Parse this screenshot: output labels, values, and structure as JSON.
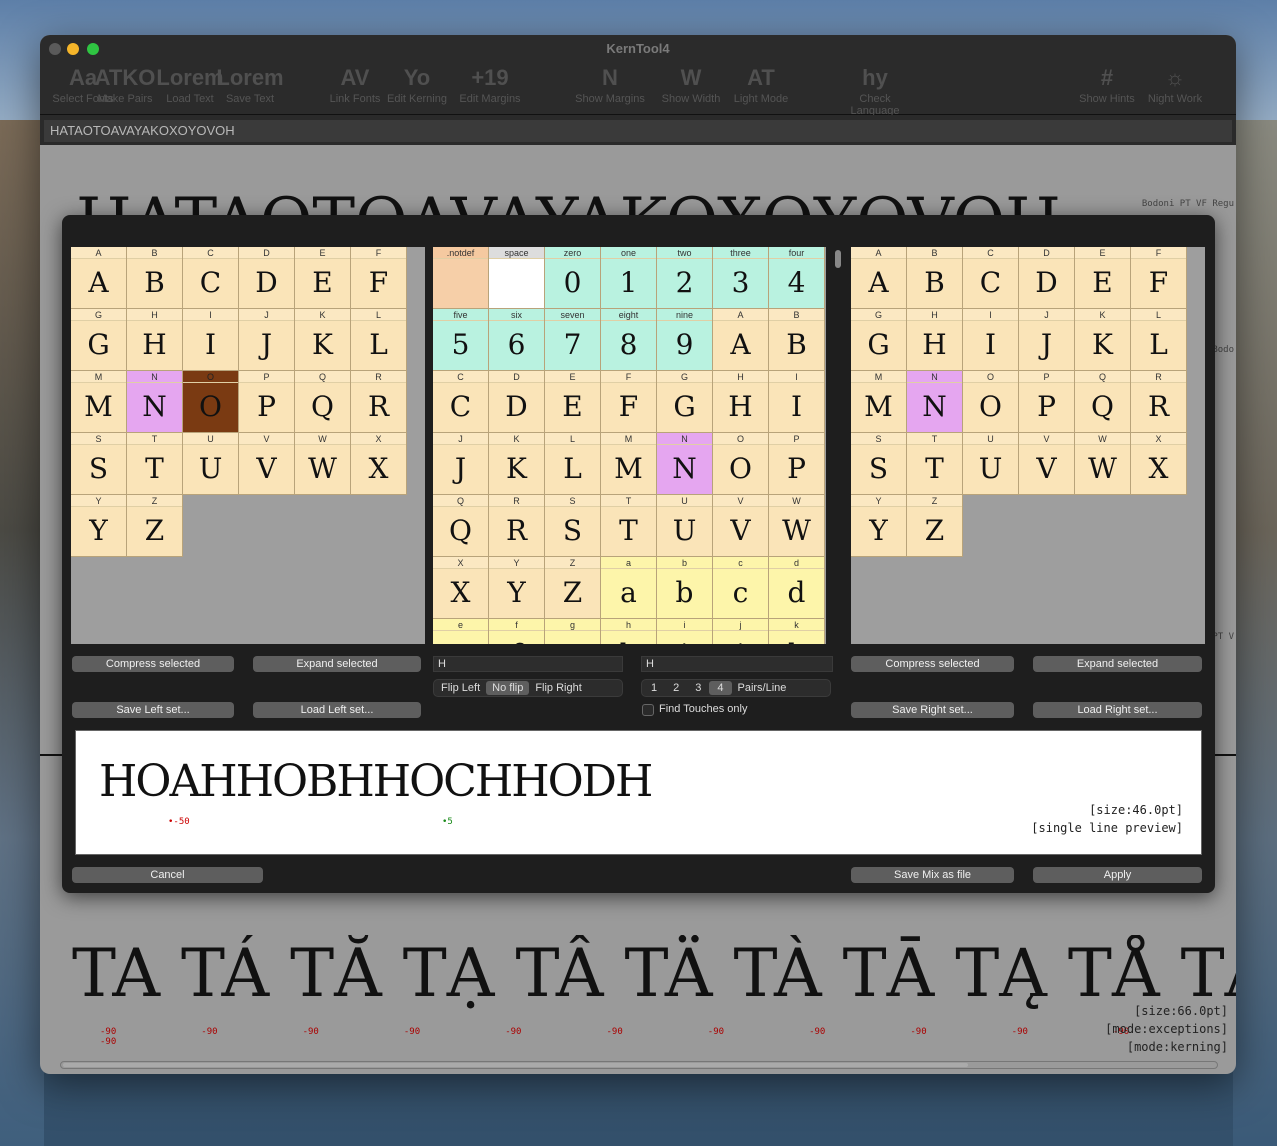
{
  "app": {
    "title": "KernTool4"
  },
  "toolbar": [
    {
      "label": "Select Fonts",
      "icon": "Aa"
    },
    {
      "label": "Make Pairs",
      "icon": "ATKO"
    },
    {
      "label": "Load Text",
      "icon": "Lorem"
    },
    {
      "label": "Save Text",
      "icon": "Lorem"
    },
    {
      "label": "Link Fonts",
      "icon": "AV"
    },
    {
      "label": "Edit Kerning",
      "icon": "Yo"
    },
    {
      "label": "Edit Margins",
      "icon": "+19"
    },
    {
      "label": "Show Margins",
      "icon": "N"
    },
    {
      "label": "Show Width",
      "icon": "W"
    },
    {
      "label": "Light Mode",
      "icon": "AT"
    },
    {
      "label": "Check Language",
      "icon": "hy"
    },
    {
      "label": "Show Hints",
      "icon": "#"
    },
    {
      "label": "Night Work",
      "icon": "☼"
    }
  ],
  "pairs_field": "HATAOTOAVAYAKOXOYOVOH",
  "main": {
    "big_text": "HATAOTOAVAYAKOXOYOVOH",
    "font_label": "Bodoni PT VF Regu",
    "side_label": "Bodo",
    "side_label2": "PT V"
  },
  "bottom": {
    "text": "TA TÁ TĂ TẠ TÂ TÄ TÀ TĀ TĄ TÅ TǺ TÃ",
    "kern_values": [
      "-90",
      "-90",
      "-90",
      "-90",
      "-90",
      "-90",
      "-90",
      "-90",
      "-90",
      "-90",
      "-90",
      "-90"
    ],
    "size": "[size:66.0pt]",
    "mode1": "[mode:exceptions]",
    "mode2": "[mode:kerning]"
  },
  "left_set": {
    "cells": [
      {
        "n": "A",
        "g": "A"
      },
      {
        "n": "B",
        "g": "B"
      },
      {
        "n": "C",
        "g": "C"
      },
      {
        "n": "D",
        "g": "D"
      },
      {
        "n": "E",
        "g": "E"
      },
      {
        "n": "F",
        "g": "F"
      },
      {
        "n": "G",
        "g": "G"
      },
      {
        "n": "H",
        "g": "H"
      },
      {
        "n": "I",
        "g": "I"
      },
      {
        "n": "J",
        "g": "J"
      },
      {
        "n": "K",
        "g": "K"
      },
      {
        "n": "L",
        "g": "L"
      },
      {
        "n": "M",
        "g": "M"
      },
      {
        "n": "N",
        "g": "N",
        "s": "sel"
      },
      {
        "n": "O",
        "g": "O",
        "s": "dark"
      },
      {
        "n": "P",
        "g": "P"
      },
      {
        "n": "Q",
        "g": "Q"
      },
      {
        "n": "R",
        "g": "R"
      },
      {
        "n": "S",
        "g": "S"
      },
      {
        "n": "T",
        "g": "T"
      },
      {
        "n": "U",
        "g": "U"
      },
      {
        "n": "V",
        "g": "V"
      },
      {
        "n": "W",
        "g": "W"
      },
      {
        "n": "X",
        "g": "X"
      },
      {
        "n": "Y",
        "g": "Y"
      },
      {
        "n": "Z",
        "g": "Z"
      }
    ]
  },
  "center_set": {
    "cells": [
      {
        "n": ".notdef",
        "g": "",
        "s": "notdef"
      },
      {
        "n": "space",
        "g": "",
        "s": "space"
      },
      {
        "n": "zero",
        "g": "0",
        "s": "fig"
      },
      {
        "n": "one",
        "g": "1",
        "s": "fig"
      },
      {
        "n": "two",
        "g": "2",
        "s": "fig"
      },
      {
        "n": "three",
        "g": "3",
        "s": "fig"
      },
      {
        "n": "four",
        "g": "4",
        "s": "fig"
      },
      {
        "n": "five",
        "g": "5",
        "s": "fig"
      },
      {
        "n": "six",
        "g": "6",
        "s": "fig"
      },
      {
        "n": "seven",
        "g": "7",
        "s": "fig"
      },
      {
        "n": "eight",
        "g": "8",
        "s": "fig"
      },
      {
        "n": "nine",
        "g": "9",
        "s": "fig"
      },
      {
        "n": "A",
        "g": "A"
      },
      {
        "n": "B",
        "g": "B"
      },
      {
        "n": "C",
        "g": "C"
      },
      {
        "n": "D",
        "g": "D"
      },
      {
        "n": "E",
        "g": "E"
      },
      {
        "n": "F",
        "g": "F"
      },
      {
        "n": "G",
        "g": "G"
      },
      {
        "n": "H",
        "g": "H"
      },
      {
        "n": "I",
        "g": "I"
      },
      {
        "n": "J",
        "g": "J"
      },
      {
        "n": "K",
        "g": "K"
      },
      {
        "n": "L",
        "g": "L"
      },
      {
        "n": "M",
        "g": "M"
      },
      {
        "n": "N",
        "g": "N",
        "s": "sel"
      },
      {
        "n": "O",
        "g": "O"
      },
      {
        "n": "P",
        "g": "P"
      },
      {
        "n": "Q",
        "g": "Q"
      },
      {
        "n": "R",
        "g": "R"
      },
      {
        "n": "S",
        "g": "S"
      },
      {
        "n": "T",
        "g": "T"
      },
      {
        "n": "U",
        "g": "U"
      },
      {
        "n": "V",
        "g": "V"
      },
      {
        "n": "W",
        "g": "W"
      },
      {
        "n": "X",
        "g": "X"
      },
      {
        "n": "Y",
        "g": "Y"
      },
      {
        "n": "Z",
        "g": "Z"
      },
      {
        "n": "a",
        "g": "a",
        "s": "low"
      },
      {
        "n": "b",
        "g": "b",
        "s": "low"
      },
      {
        "n": "c",
        "g": "c",
        "s": "low"
      },
      {
        "n": "d",
        "g": "d",
        "s": "low"
      },
      {
        "n": "e",
        "g": "e",
        "s": "low"
      },
      {
        "n": "f",
        "g": "f",
        "s": "low"
      },
      {
        "n": "g",
        "g": "g",
        "s": "low"
      },
      {
        "n": "h",
        "g": "h",
        "s": "low"
      },
      {
        "n": "i",
        "g": "i",
        "s": "low"
      },
      {
        "n": "j",
        "g": "j",
        "s": "low"
      },
      {
        "n": "k",
        "g": "k",
        "s": "low"
      }
    ]
  },
  "right_set": {
    "cells": [
      {
        "n": "A",
        "g": "A"
      },
      {
        "n": "B",
        "g": "B"
      },
      {
        "n": "C",
        "g": "C"
      },
      {
        "n": "D",
        "g": "D"
      },
      {
        "n": "E",
        "g": "E"
      },
      {
        "n": "F",
        "g": "F"
      },
      {
        "n": "G",
        "g": "G"
      },
      {
        "n": "H",
        "g": "H"
      },
      {
        "n": "I",
        "g": "I"
      },
      {
        "n": "J",
        "g": "J"
      },
      {
        "n": "K",
        "g": "K"
      },
      {
        "n": "L",
        "g": "L"
      },
      {
        "n": "M",
        "g": "M"
      },
      {
        "n": "N",
        "g": "N",
        "s": "sel"
      },
      {
        "n": "O",
        "g": "O"
      },
      {
        "n": "P",
        "g": "P"
      },
      {
        "n": "Q",
        "g": "Q"
      },
      {
        "n": "R",
        "g": "R"
      },
      {
        "n": "S",
        "g": "S"
      },
      {
        "n": "T",
        "g": "T"
      },
      {
        "n": "U",
        "g": "U"
      },
      {
        "n": "V",
        "g": "V"
      },
      {
        "n": "W",
        "g": "W"
      },
      {
        "n": "X",
        "g": "X"
      },
      {
        "n": "Y",
        "g": "Y"
      },
      {
        "n": "Z",
        "g": "Z"
      }
    ]
  },
  "controls": {
    "compress_left": "Compress selected",
    "expand_left": "Expand selected",
    "compress_right": "Compress selected",
    "expand_right": "Expand selected",
    "save_left": "Save Left set...",
    "load_left": "Load Left set...",
    "save_right": "Save Right set...",
    "load_right": "Load Right set...",
    "left_field": "H",
    "right_field": "H",
    "flip": [
      "Flip Left",
      "No flip",
      "Flip Right"
    ],
    "pairs": [
      "1",
      "2",
      "3",
      "4",
      "Pairs/Line"
    ],
    "find_touches": "Find Touches only",
    "cancel": "Cancel",
    "save_mix": "Save Mix as file",
    "apply": "Apply"
  },
  "preview": {
    "text": "HOAHHOBHHOCHHODH",
    "kern1": "-50",
    "kern2": "5",
    "size": "[size:46.0pt]",
    "mode": "[single line preview]"
  }
}
